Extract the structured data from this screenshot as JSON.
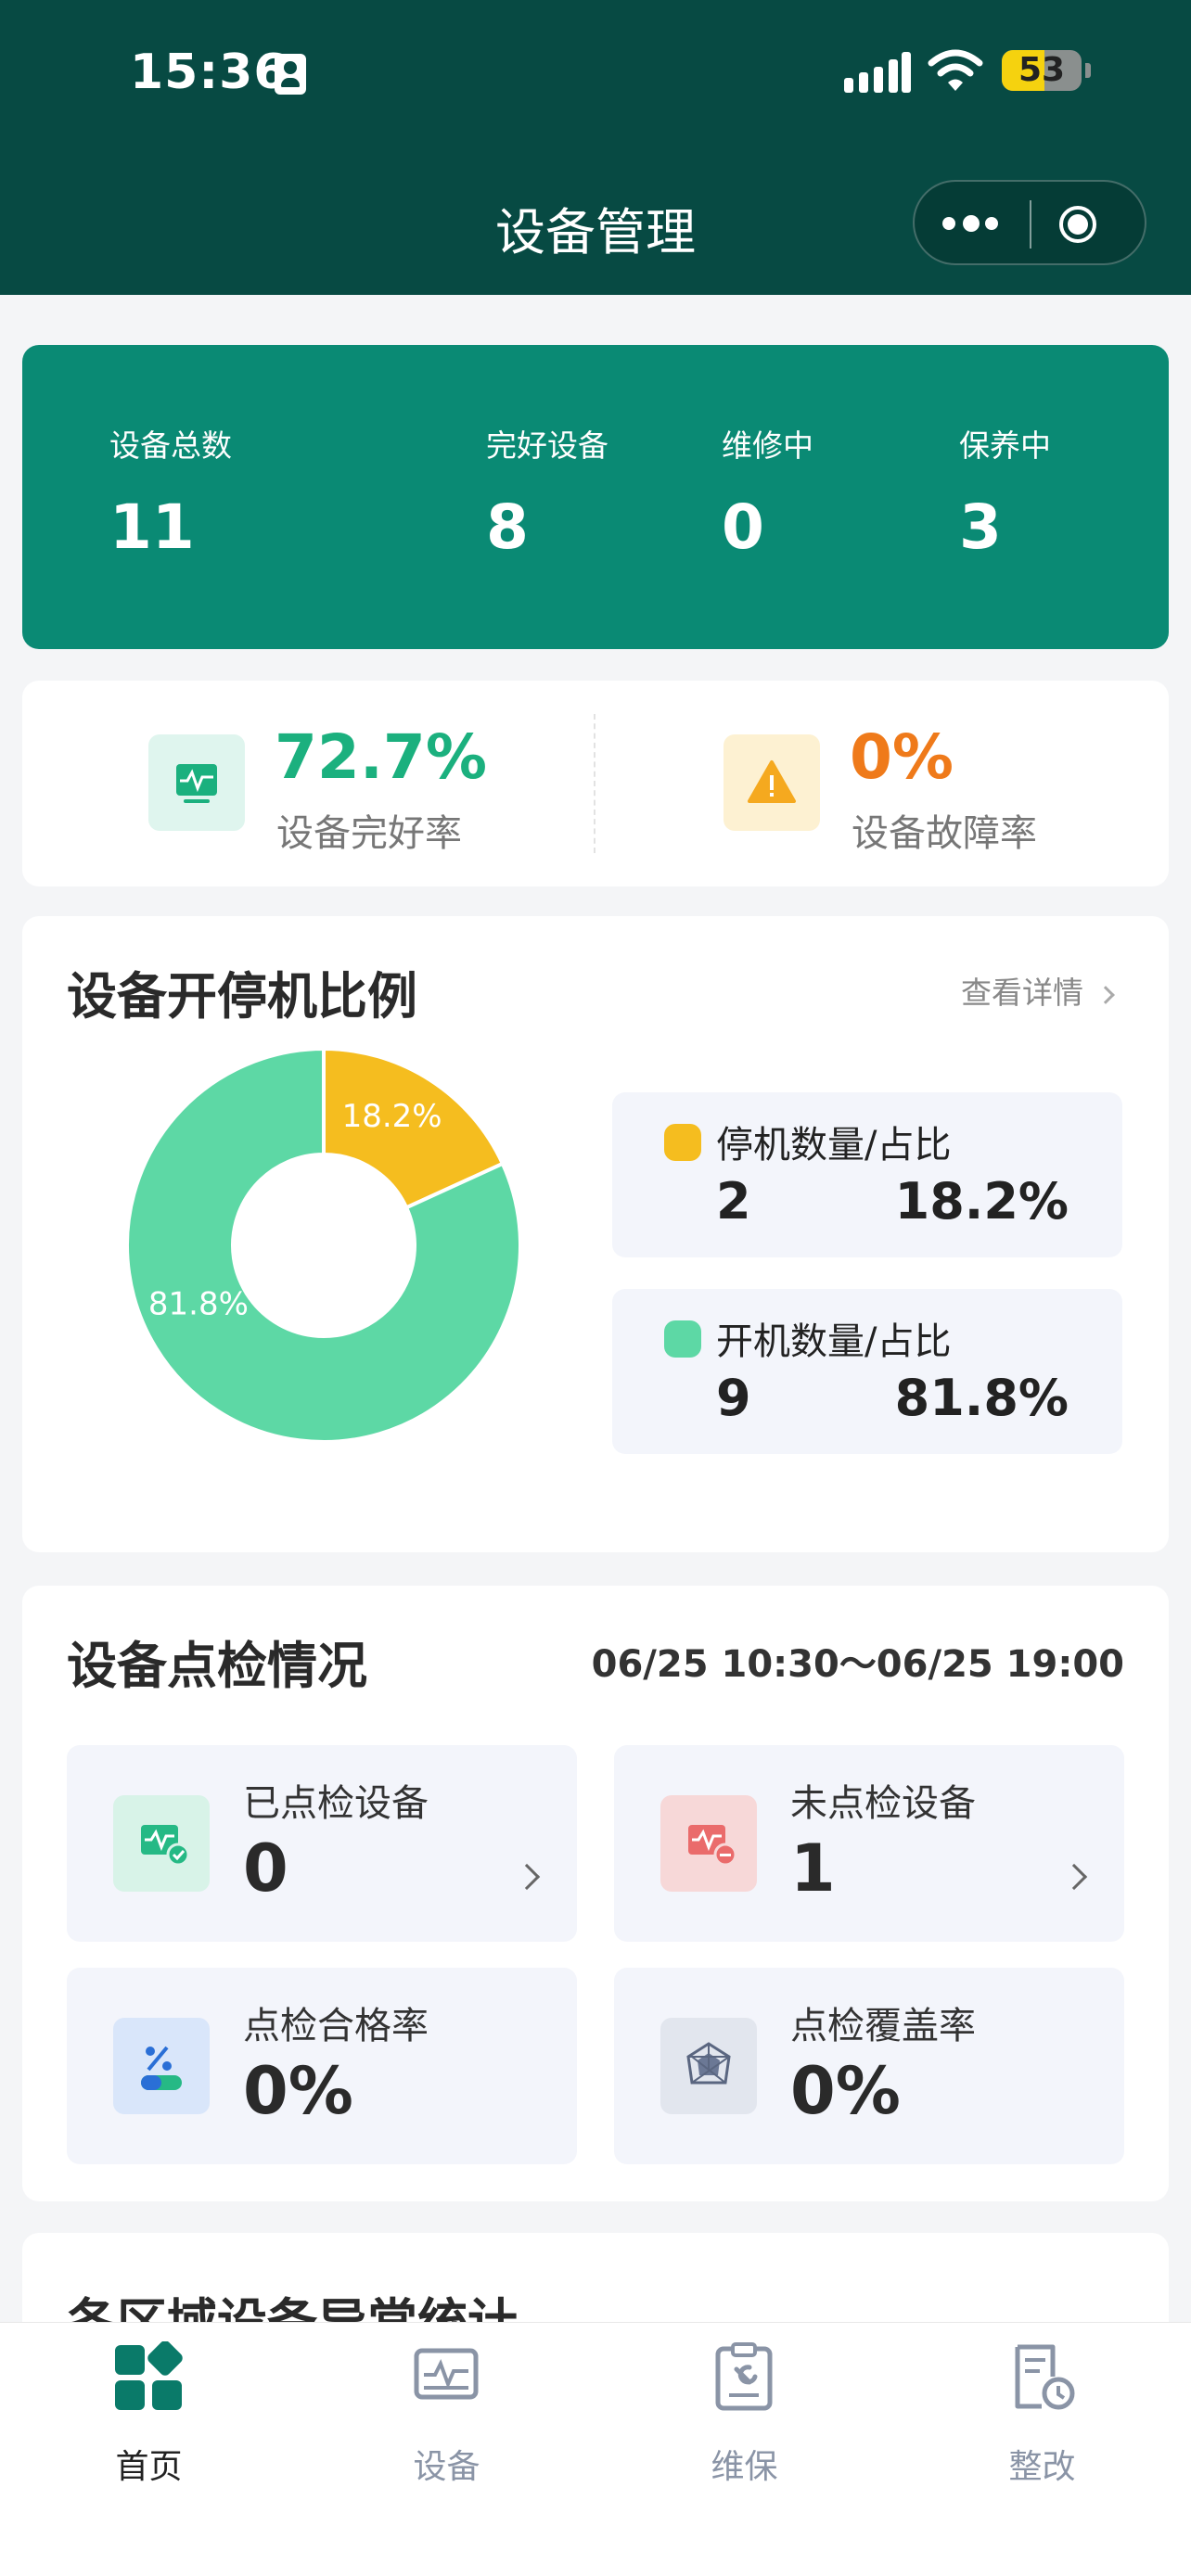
{
  "status_bar": {
    "time": "15:36",
    "battery": "53"
  },
  "header": {
    "title": "设备管理"
  },
  "summary": [
    {
      "label": "设备总数",
      "value": "11"
    },
    {
      "label": "完好设备",
      "value": "8"
    },
    {
      "label": "维修中",
      "value": "0"
    },
    {
      "label": "保养中",
      "value": "3"
    }
  ],
  "rates": {
    "intact": {
      "value": "72.7%",
      "label": "设备完好率",
      "color": "#1bb07e"
    },
    "fault": {
      "value": "0%",
      "label": "设备故障率",
      "color": "#ef7a1a"
    }
  },
  "ratio": {
    "title": "设备开停机比例",
    "detail_link": "查看详情",
    "stopped": {
      "label": "停机数量/占比",
      "count": "2",
      "percent": "18.2%",
      "color": "#f5bd1f"
    },
    "running": {
      "label": "开机数量/占比",
      "count": "9",
      "percent": "81.8%",
      "color": "#5dd8a5"
    }
  },
  "chart_data": {
    "type": "pie",
    "categories": [
      "停机数量/占比",
      "开机数量/占比"
    ],
    "values": [
      2,
      9
    ],
    "percent_labels": [
      "18.2%",
      "81.8%"
    ],
    "colors": [
      "#f5bd1f",
      "#5dd8a5"
    ],
    "donut": true
  },
  "inspection": {
    "title": "设备点检情况",
    "range": "06/25 10:30～06/25 19:00",
    "tiles": [
      {
        "label": "已点检设备",
        "value": "0"
      },
      {
        "label": "未点检设备",
        "value": "1"
      },
      {
        "label": "点检合格率",
        "value": "0%"
      },
      {
        "label": "点检覆盖率",
        "value": "0%"
      }
    ]
  },
  "abnormal": {
    "title": "各区域设备异常统计"
  },
  "tabbar": {
    "active_color": "#0a7a69",
    "inactive_color": "#8a94a6",
    "items": [
      {
        "label": "首页",
        "icon": "home-grid-icon"
      },
      {
        "label": "设备",
        "icon": "device-monitor-icon"
      },
      {
        "label": "维保",
        "icon": "maintenance-clipboard-icon"
      },
      {
        "label": "整改",
        "icon": "rectify-document-clock-icon"
      }
    ]
  }
}
